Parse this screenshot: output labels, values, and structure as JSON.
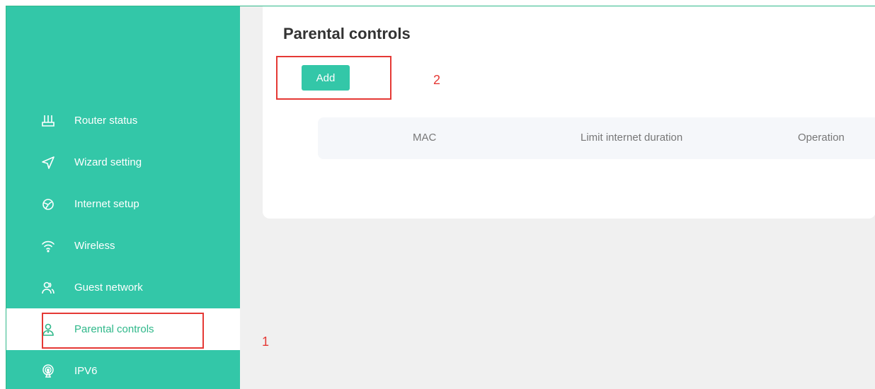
{
  "sidebar": {
    "items": [
      {
        "label": "Router status",
        "icon": "router-icon",
        "active": false
      },
      {
        "label": "Wizard setting",
        "icon": "send-icon",
        "active": false
      },
      {
        "label": "Internet setup",
        "icon": "globe-icon",
        "active": false
      },
      {
        "label": "Wireless",
        "icon": "wifi-icon",
        "active": false
      },
      {
        "label": "Guest network",
        "icon": "users-icon",
        "active": false
      },
      {
        "label": "Parental controls",
        "icon": "parental-icon",
        "active": true
      },
      {
        "label": "IPV6",
        "icon": "broadcast-icon",
        "active": false
      }
    ]
  },
  "main": {
    "title": "Parental controls",
    "add_label": "Add",
    "table": {
      "columns": [
        "MAC",
        "Limit internet duration",
        "Operation"
      ],
      "rows": []
    }
  },
  "annotations": {
    "marker_1": "1",
    "marker_2": "2"
  },
  "colors": {
    "accent": "#33c7a8",
    "annotation": "#e53935",
    "background": "#f0f0f0"
  }
}
